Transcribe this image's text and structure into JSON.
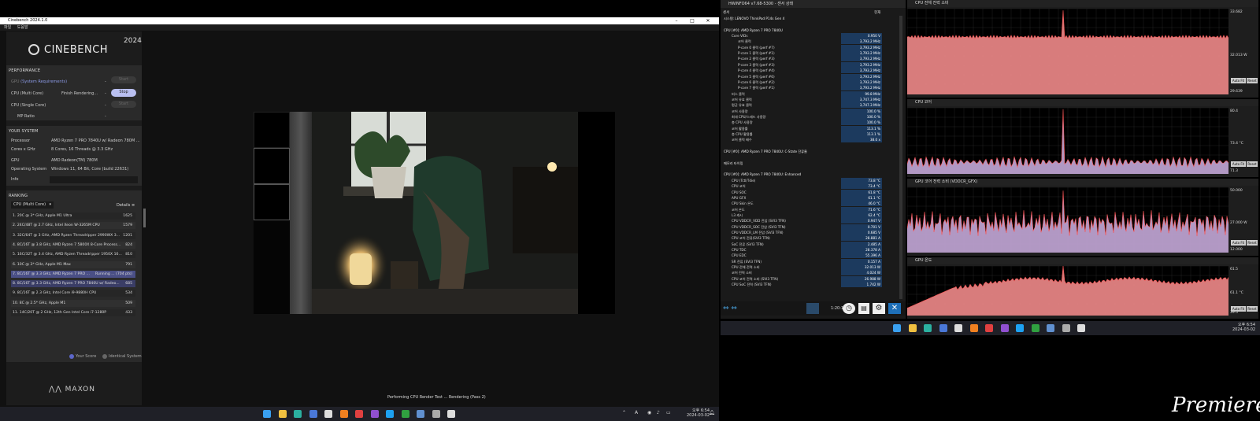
{
  "cinebench": {
    "window_title": "Cinebench 2024.1.0",
    "menu": [
      "파일",
      "도움말"
    ],
    "logo_text": "CINEBENCH",
    "version_badge": "2024",
    "performance": {
      "heading": "PERFORMANCE",
      "gpu_label": "GPU",
      "gpu_note": "(System Requirements)",
      "gpu_dash": "-",
      "gpu_button": "Start",
      "multi_label": "CPU (Multi Core)",
      "multi_status": "Finish Rendering...",
      "multi_dash": "-",
      "multi_button": "Stop",
      "single_label": "CPU (Single Core)",
      "single_dash": "-",
      "single_button": "Start",
      "mp_label": "MP Ratio",
      "mp_value": "-"
    },
    "system": {
      "heading": "YOUR SYSTEM",
      "rows": [
        {
          "k": "Processor",
          "v": "AMD Ryzen 7 PRO 7840U w/ Radeon 780M ..."
        },
        {
          "k": "Cores x GHz",
          "v": "8 Cores, 16 Threads @ 3.3 GHz"
        },
        {
          "k": "GPU",
          "v": "AMD Radeon(TM) 780M"
        },
        {
          "k": "Operating System",
          "v": "Windows 11, 64 Bit, Core (build 22631)"
        },
        {
          "k": "Info",
          "v": ""
        }
      ]
    },
    "ranking": {
      "heading": "RANKING",
      "dropdown": "CPU (Multi Core)",
      "details": "Details",
      "rows": [
        {
          "t": "1. 20C @ 3* GHz, Apple M1 Ultra",
          "v": "1625"
        },
        {
          "t": "2. 24C/48T @ 2.7 GHz, Intel Xeon W-3265M CPU",
          "v": "1579"
        },
        {
          "t": "3. 32C/64T @ 3 GHz, AMD Ryzen Threadripper 2990WX 3...",
          "v": "1201"
        },
        {
          "t": "4. 8C/16T @ 3.8 GHz, AMD Ryzen 7 5800X 8-Core Process...",
          "v": "824"
        },
        {
          "t": "5. 16C/32T @ 3.4 GHz, AMD Ryzen Threadripper 1950X 16...",
          "v": "810"
        },
        {
          "t": "6. 10C @ 3* GHz, Apple M1 Max",
          "v": "791"
        },
        {
          "t": "7. 8C/16T @ 3.3 GHz, AMD Ryzen 7 PRO ...",
          "v": "Running ... (704 pts)"
        },
        {
          "t": "8. 8C/16T @ 3.3 GHz, AMD Ryzen 7 PRO 7840U w/ Radeo...",
          "v": "685"
        },
        {
          "t": "9. 8C/16T @ 2.3 GHz, Intel Core i9-9880H CPU",
          "v": "534"
        },
        {
          "t": "10. 8C @ 2.5* GHz, Apple M1",
          "v": "509"
        },
        {
          "t": "11. 14C/20T @ 2 GHz, 12th Gen Intel Core i7-1280P",
          "v": "433"
        }
      ],
      "legend_your": "Your Score",
      "legend_identical": "Identical System"
    },
    "maxon": "MAXON",
    "status": "Performing CPU Render Test ... Rendering (Pass 2)"
  },
  "hwinfo": {
    "window_title": "HWiNFO64 v7.68-5300 - 센서 상태",
    "col_sensor": "센서",
    "col_current": "현재",
    "rows": [
      {
        "n": "시스템: LENOVO ThinkPad P14s Gen 4",
        "v": "",
        "type": "group"
      },
      {
        "n": "",
        "v": "",
        "type": "blank"
      },
      {
        "n": "CPU [#0]: AMD Ryzen 7 PRO 7840U",
        "v": "",
        "type": "group"
      },
      {
        "n": "Core VIDs",
        "v": "0.950 V"
      },
      {
        "n": "코어 클럭",
        "v": "3,793.2 MHz"
      },
      {
        "n": "P-core 0 클럭 (perf #7)",
        "v": "3,793.2 MHz"
      },
      {
        "n": "P-core 1 클럭 (perf #1)",
        "v": "3,793.2 MHz"
      },
      {
        "n": "P-core 2 클럭 (perf #3)",
        "v": "3,793.2 MHz"
      },
      {
        "n": "P-core 3 클럭 (perf #3)",
        "v": "3,793.2 MHz"
      },
      {
        "n": "P-core 4 클럭 (perf #4)",
        "v": "3,793.2 MHz"
      },
      {
        "n": "P-core 5 클럭 (perf #6)",
        "v": "3,793.2 MHz"
      },
      {
        "n": "P-core 6 클럭 (perf #2)",
        "v": "3,793.2 MHz"
      },
      {
        "n": "P-core 7 클럭 (perf #1)",
        "v": "3,793.2 MHz"
      },
      {
        "n": "버스 클럭",
        "v": "99.8 MHz"
      },
      {
        "n": "코어 유효 클럭",
        "v": "3,747.3 MHz"
      },
      {
        "n": "평균 유효 클럭",
        "v": "3,747.3 MHz"
      },
      {
        "n": "코어 사용량",
        "v": "100.0 %"
      },
      {
        "n": "최대 CPU/스레드 사용량",
        "v": "100.0 %"
      },
      {
        "n": "총 CPU 사용량",
        "v": "100.0 %"
      },
      {
        "n": "코어 활용률",
        "v": "113.1 %"
      },
      {
        "n": "총 CPU 활용률",
        "v": "113.1 %"
      },
      {
        "n": "코어 클럭 배수",
        "v": "38.0 x"
      },
      {
        "n": "",
        "v": "",
        "type": "blank"
      },
      {
        "n": "CPU [#0]: AMD Ryzen 7 PRO 7840U: C-State 잔류율",
        "v": "",
        "type": "group"
      },
      {
        "n": "",
        "v": "",
        "type": "blank"
      },
      {
        "n": "메모리 타이밍",
        "v": "",
        "type": "group"
      },
      {
        "n": "",
        "v": "",
        "type": "blank"
      },
      {
        "n": "CPU [#0]: AMD Ryzen 7 PRO 7840U: Enhanced",
        "v": "",
        "type": "group"
      },
      {
        "n": "CPU (Tctl/Tdie)",
        "v": "73.8 °C"
      },
      {
        "n": "CPU 코어",
        "v": "73.4 °C"
      },
      {
        "n": "CPU SOC",
        "v": "61.8 °C"
      },
      {
        "n": "APU GFX",
        "v": "61.1 °C"
      },
      {
        "n": "CPU Skin 온도",
        "v": "46.0 °C"
      },
      {
        "n": "코어 온도",
        "v": "71.6 °C"
      },
      {
        "n": "L3 캐시",
        "v": "62.4 °C"
      },
      {
        "n": "CPU VDDCR_VDD 전압 (SVI3 TFN)",
        "v": "0.947 V"
      },
      {
        "n": "CPU VDDCR_SOC 전압 (SVI3 TFN)",
        "v": "0.701 V"
      },
      {
        "n": "CPU VDDCR_LM 전압 (SVI3 TFN)",
        "v": "0.685 V"
      },
      {
        "n": "CPU 코어 전류(SVI3 TFN)",
        "v": "28.881 A"
      },
      {
        "n": "SoC 전류 (SVI3 TFN)",
        "v": "2.485 A"
      },
      {
        "n": "CPU TDC",
        "v": "28.378 A"
      },
      {
        "n": "CPU EDC",
        "v": "55.396 A"
      },
      {
        "n": "SR 전류 (SVI3 TFN)",
        "v": "0.157 A"
      },
      {
        "n": "CPU 전체 전력 소비",
        "v": "32.013 W"
      },
      {
        "n": "코어 전력 소비",
        "v": "4.024 W"
      },
      {
        "n": "CPU 코어 전력 소비 (SVI3 TFN)",
        "v": "26.988 W"
      },
      {
        "n": "CPU SoC 전력 (SVI3 TFN)",
        "v": "1.742 W"
      }
    ],
    "timer": "1:20:16"
  },
  "graphs": [
    {
      "title": "CPU 전체 전력 소비",
      "max": "33.682",
      "cur": "32.013 W",
      "min": "29.639"
    },
    {
      "title": "CPU 코어",
      "max": "80.4",
      "cur": "73.4 °C",
      "min": "71.3"
    },
    {
      "title": "GPU 코어 전력 소비 (VDDCR_GFX)",
      "max": "50.000",
      "cur": "27.000 W",
      "min": "12.000"
    },
    {
      "title": "GPU 온도",
      "max": "61.5",
      "cur": "61.1 °C",
      "min": "39.5"
    }
  ],
  "graph_buttons": {
    "auto": "Auto Fit",
    "reset": "Reset"
  },
  "taskbar": {
    "time": "오후 6:54",
    "date": "2024-03-02",
    "time2": "오후 6:54",
    "date2": "2024-03-02",
    "tray": "A"
  },
  "watermark": "Premiere",
  "colors": {
    "accent": "#5c66c9",
    "graph_fill": "#f08a8a",
    "graph_violet": "#c4a9d8"
  }
}
